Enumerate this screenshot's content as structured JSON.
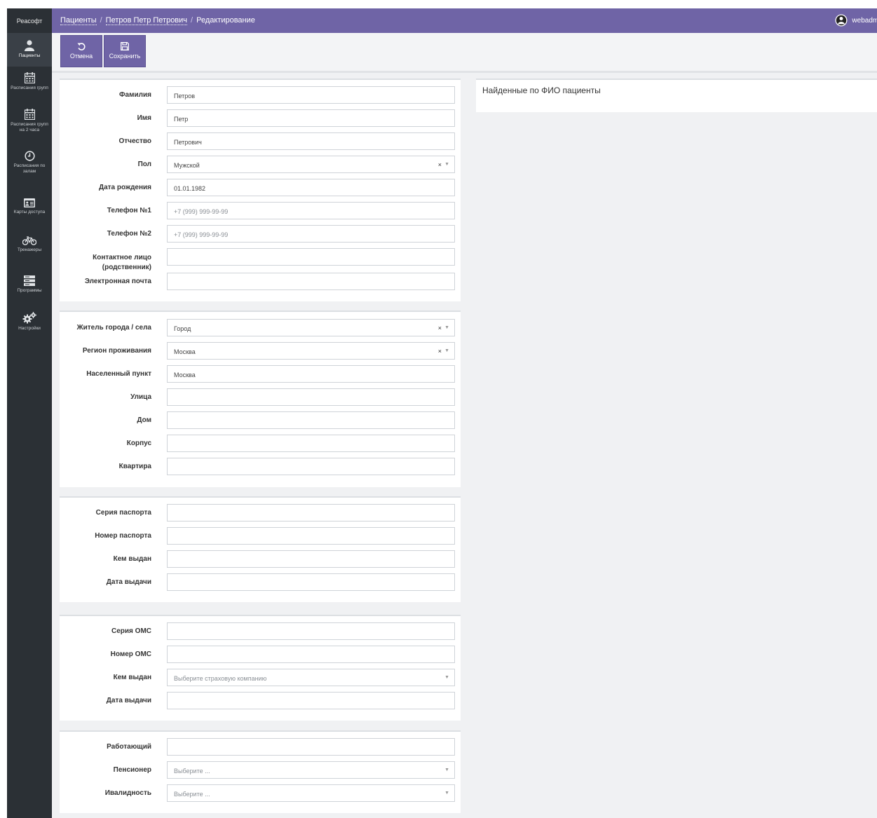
{
  "app": {
    "brand": "Реасофт",
    "user": "webadmin"
  },
  "breadcrumb": {
    "patients": "Пациенты",
    "patient": "Петров Петр Петрович",
    "current": "Редактирование"
  },
  "sidebar": {
    "items": [
      {
        "label": "Пациенты",
        "icon": "user-icon"
      },
      {
        "label": "Расписания групп",
        "icon": "calendar-icon"
      },
      {
        "label": "Расписания групп на 2 часа",
        "icon": "calendar-icon"
      },
      {
        "label": "Расписания по залам",
        "icon": "clock-icon"
      },
      {
        "label": "Карты доступа",
        "icon": "id-card-icon"
      },
      {
        "label": "Тренажеры",
        "icon": "bicycle-icon"
      },
      {
        "label": "Программы",
        "icon": "server-icon"
      },
      {
        "label": "Настройки",
        "icon": "gears-icon"
      }
    ]
  },
  "toolbar": {
    "cancel_label": "Отмена",
    "save_label": "Сохранить"
  },
  "personal": {
    "last_name": {
      "label": "Фамилия",
      "value": "Петров"
    },
    "first_name": {
      "label": "Имя",
      "value": "Петр"
    },
    "middle_name": {
      "label": "Отчество",
      "value": "Петрович"
    },
    "gender": {
      "label": "Пол",
      "value": "Мужской"
    },
    "birth_date": {
      "label": "Дата рождения",
      "value": "01.01.1982"
    },
    "phone1": {
      "label": "Телефон №1",
      "placeholder": "+7 (999) 999-99-99"
    },
    "phone2": {
      "label": "Телефон №2",
      "placeholder": "+7 (999) 999-99-99"
    },
    "contact": {
      "label_line1": "Контактное лицо",
      "label_line2": "(родственник)",
      "value": ""
    },
    "email": {
      "label": "Электронная почта",
      "value": ""
    }
  },
  "address": {
    "resident": {
      "label": "Житель города / села",
      "value": "Город"
    },
    "region": {
      "label": "Регион проживания",
      "value": "Москва"
    },
    "locality": {
      "label": "Населенный пункт",
      "value": "Москва"
    },
    "street": {
      "label": "Улица",
      "value": ""
    },
    "house": {
      "label": "Дом",
      "value": ""
    },
    "building": {
      "label": "Корпус",
      "value": ""
    },
    "apartment": {
      "label": "Квартира",
      "value": ""
    }
  },
  "passport": {
    "series": {
      "label": "Серия паспорта",
      "value": ""
    },
    "number": {
      "label": "Номер паспорта",
      "value": ""
    },
    "issued_by": {
      "label": "Кем выдан",
      "value": ""
    },
    "issue_date": {
      "label": "Дата выдачи",
      "value": ""
    }
  },
  "oms": {
    "series": {
      "label": "Серия ОМС",
      "value": ""
    },
    "number": {
      "label": "Номер ОМС",
      "value": ""
    },
    "issued_by": {
      "label": "Кем выдан",
      "placeholder": "Выберите страховую компанию"
    },
    "issue_date": {
      "label": "Дата выдачи",
      "value": ""
    }
  },
  "social": {
    "working": {
      "label": "Работающий",
      "value": ""
    },
    "pensioner": {
      "label": "Пенсионер",
      "placeholder": "Выберите ..."
    },
    "disability": {
      "label": "Ивалидность",
      "placeholder": "Выберите ..."
    }
  },
  "found_panel": {
    "title": "Найденные по ФИО пациенты"
  },
  "colors": {
    "accent": "#6f64a6",
    "sidebar": "#2b3035",
    "content_bg": "#f0f1f3"
  }
}
